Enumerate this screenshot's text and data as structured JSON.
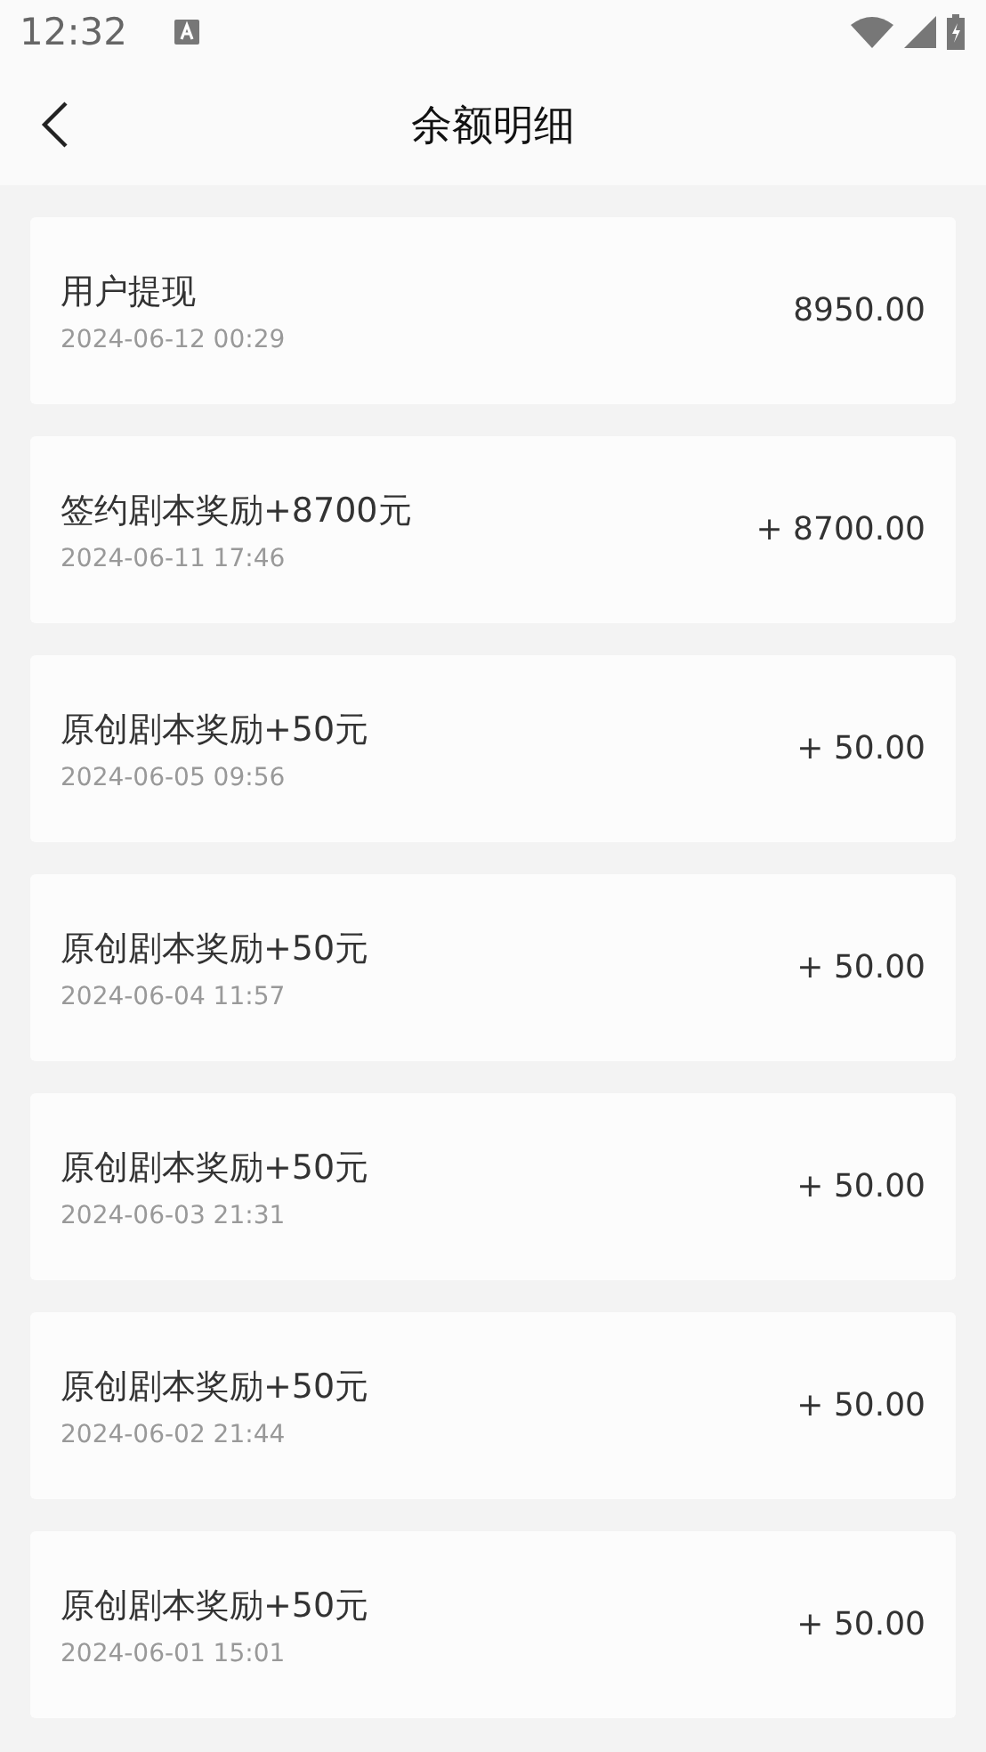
{
  "status_bar": {
    "time": "12:32"
  },
  "header": {
    "title": "余额明细"
  },
  "records": [
    {
      "title": "用户提现",
      "time": "2024-06-12 00:29",
      "amount": "8950.00"
    },
    {
      "title": "签约剧本奖励+8700元",
      "time": "2024-06-11 17:46",
      "amount": "+ 8700.00"
    },
    {
      "title": "原创剧本奖励+50元",
      "time": "2024-06-05 09:56",
      "amount": "+ 50.00"
    },
    {
      "title": "原创剧本奖励+50元",
      "time": "2024-06-04 11:57",
      "amount": "+ 50.00"
    },
    {
      "title": "原创剧本奖励+50元",
      "time": "2024-06-03 21:31",
      "amount": "+ 50.00"
    },
    {
      "title": "原创剧本奖励+50元",
      "time": "2024-06-02 21:44",
      "amount": "+ 50.00"
    },
    {
      "title": "原创剧本奖励+50元",
      "time": "2024-06-01 15:01",
      "amount": "+ 50.00"
    }
  ]
}
